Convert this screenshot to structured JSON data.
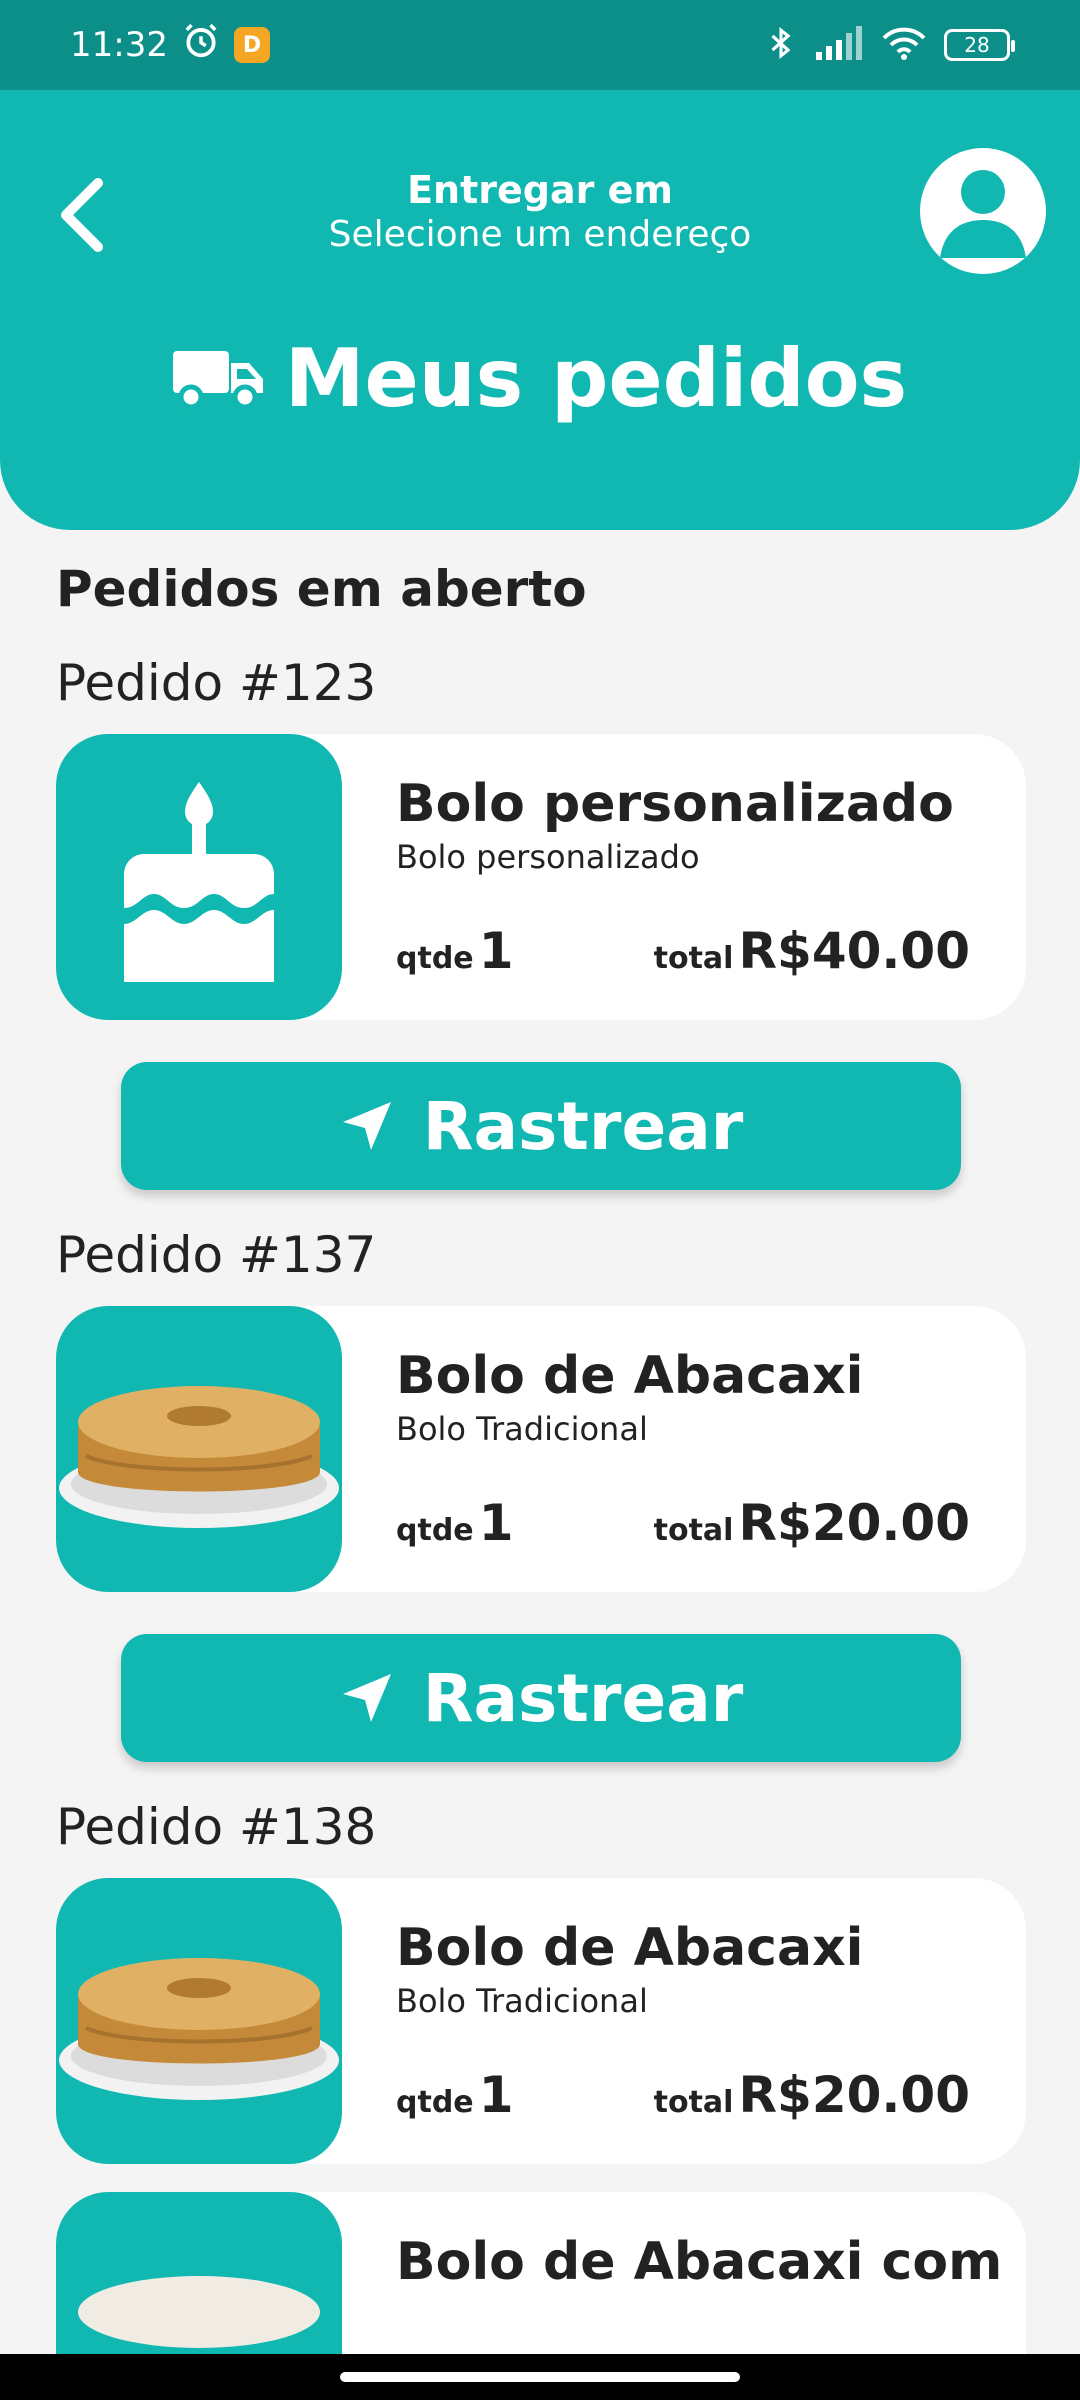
{
  "status_bar": {
    "time": "11:32",
    "battery": "28"
  },
  "header": {
    "deliver_title": "Entregar em",
    "deliver_subtitle": "Selecione um endereço",
    "page_title": "Meus pedidos"
  },
  "section_title": "Pedidos em aberto",
  "track_label": "Rastrear",
  "qty_label": "qtde",
  "total_label": "total",
  "orders": [
    {
      "label": "Pedido #123",
      "name": "Bolo personalizado",
      "category": "Bolo personalizado",
      "qty": "1",
      "total": "R$40.00",
      "image": "birthday-cake-icon"
    },
    {
      "label": "Pedido #137",
      "name": "Bolo de Abacaxi",
      "category": "Bolo Tradicional",
      "qty": "1",
      "total": "R$20.00",
      "image": "cake-photo"
    },
    {
      "label": "Pedido #138",
      "name": "Bolo de Abacaxi",
      "category": "Bolo Tradicional",
      "qty": "1",
      "total": "R$20.00",
      "image": "cake-photo"
    }
  ],
  "partial_order": {
    "name": "Bolo de Abacaxi com"
  },
  "colors": {
    "primary": "#10b8b1",
    "status_bar": "#0c8f89",
    "background": "#f4f4f4"
  }
}
